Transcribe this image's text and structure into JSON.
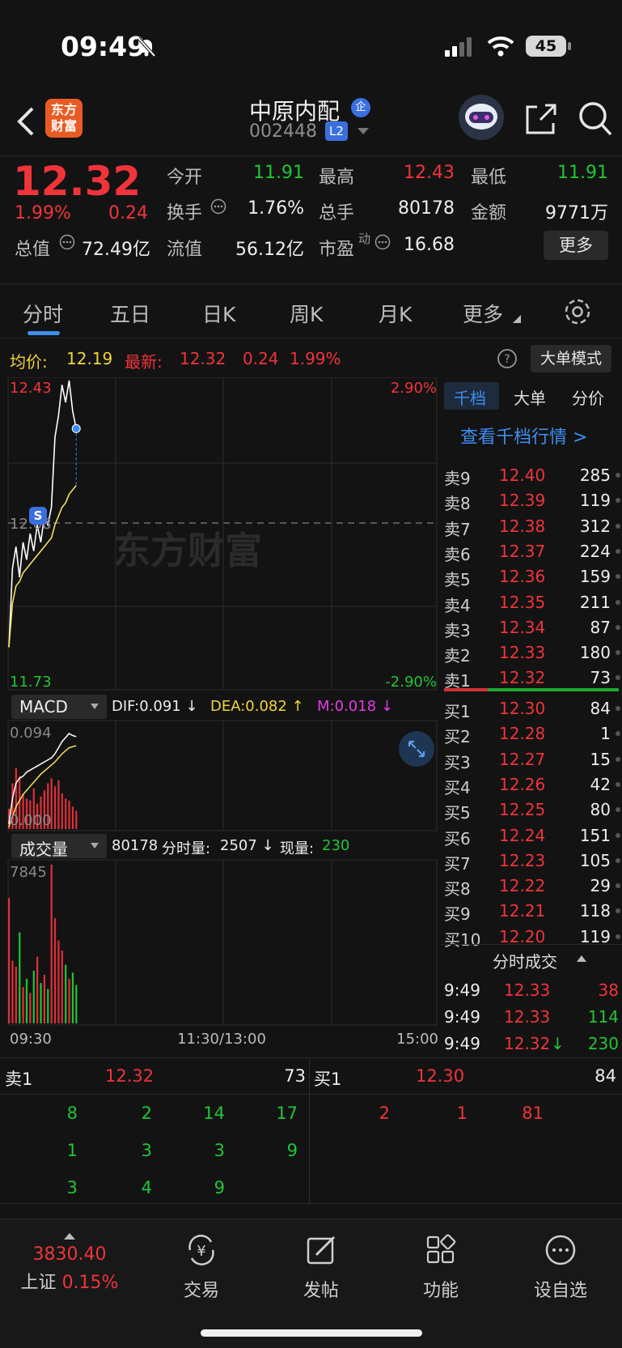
{
  "status_bar": {
    "time": "09:49",
    "battery": "45"
  },
  "header": {
    "logo_text": "东方\n财富",
    "stock_name": "中原内配",
    "badge": "企",
    "code": "002448",
    "level": "L2"
  },
  "quote": {
    "price": "12.32",
    "change_pct": "1.99%",
    "change": "0.24",
    "open_label": "今开",
    "open": "11.91",
    "high_label": "最高",
    "high": "12.43",
    "low_label": "最低",
    "low": "11.91",
    "turnover_label": "换手",
    "turnover": "1.76%",
    "volume_label": "总手",
    "volume": "80178",
    "amount_label": "金额",
    "amount": "9771万",
    "mktcap_label": "总值",
    "mktcap": "72.49亿",
    "float_label": "流值",
    "float": "56.12亿",
    "pe_label": "市盈",
    "pe_sup": "动",
    "pe": "16.68",
    "more_button": "更多"
  },
  "tabs": [
    "分时",
    "五日",
    "日K",
    "周K",
    "月K",
    "更多"
  ],
  "avg_line": {
    "avg_label": "均价:",
    "avg": "12.19",
    "latest_label": "最新:",
    "latest": "12.32",
    "change": "0.24",
    "pct": "1.99%",
    "mode_button": "大单模式"
  },
  "price_chart": {
    "y_top": "12.43",
    "y_mid": "12.08",
    "y_bottom": "11.73",
    "pct_top": "2.90%",
    "pct_bottom": "-2.90%",
    "watermark": "东方财富",
    "marker": "S"
  },
  "macd": {
    "selector": "MACD",
    "dif": "DIF:0.091",
    "dea": "DEA:0.082",
    "m": "M:0.018",
    "y_top": "0.094",
    "y_bottom": "0.000"
  },
  "volume_panel": {
    "selector": "成交量",
    "total": "80178",
    "period_label": "分时量:",
    "period": "2507",
    "current_label": "现量:",
    "current": "230",
    "y_top": "7845"
  },
  "time_axis": [
    "09:30",
    "11:30/13:00",
    "15:00"
  ],
  "chart_data": {
    "type": "line",
    "title": "",
    "x": [
      "09:30",
      "09:31",
      "09:32",
      "09:33",
      "09:34",
      "09:35",
      "09:36",
      "09:37",
      "09:38",
      "09:39",
      "09:40",
      "09:41",
      "09:42",
      "09:43",
      "09:44",
      "09:45",
      "09:46",
      "09:47",
      "09:48",
      "09:49"
    ],
    "series": [
      {
        "name": "",
        "values": [
          11.82,
          12.0,
          12.05,
          11.98,
          12.06,
          12.02,
          12.08,
          12.04,
          12.1,
          12.06,
          12.12,
          12.1,
          12.14,
          12.3,
          12.35,
          12.42,
          12.38,
          12.43,
          12.36,
          12.32
        ]
      },
      {
        "name": "均价",
        "values": [
          11.82,
          11.92,
          11.96,
          11.97,
          11.99,
          12.0,
          12.01,
          12.02,
          12.03,
          12.04,
          12.05,
          12.06,
          12.07,
          12.1,
          12.12,
          12.14,
          12.15,
          12.17,
          12.18,
          12.19
        ]
      }
    ],
    "ylim": [
      11.73,
      12.43
    ],
    "macd_bars": [
      0.02,
      0.045,
      0.06,
      0.052,
      0.035,
      0.03,
      0.028,
      0.04,
      0.025,
      0.032,
      0.038,
      0.045,
      0.05,
      0.042,
      0.048,
      0.035,
      0.03,
      0.028,
      0.022,
      0.018
    ],
    "macd_dif": [
      0.005,
      0.03,
      0.045,
      0.05,
      0.052,
      0.056,
      0.058,
      0.06,
      0.062,
      0.064,
      0.066,
      0.068,
      0.07,
      0.074,
      0.08,
      0.086,
      0.09,
      0.094,
      0.092,
      0.091
    ],
    "macd_dea": [
      0.002,
      0.012,
      0.022,
      0.028,
      0.034,
      0.038,
      0.042,
      0.046,
      0.05,
      0.054,
      0.057,
      0.06,
      0.063,
      0.066,
      0.07,
      0.074,
      0.077,
      0.08,
      0.081,
      0.082
    ],
    "macd_ylim": [
      0.0,
      0.094
    ],
    "volume": [
      6200,
      3100,
      2800,
      4500,
      1800,
      2200,
      1500,
      2600,
      3300,
      2000,
      2400,
      1700,
      7845,
      5200,
      4100,
      3600,
      2900,
      2200,
      2507,
      1900
    ],
    "volume_ylim": [
      0,
      7845
    ]
  },
  "order_book": {
    "tabs": [
      "千档",
      "大单",
      "分价"
    ],
    "view_link": "查看千档行情 >",
    "asks": [
      {
        "label": "卖9",
        "price": "12.40",
        "vol": "285"
      },
      {
        "label": "卖8",
        "price": "12.39",
        "vol": "119"
      },
      {
        "label": "卖7",
        "price": "12.38",
        "vol": "312"
      },
      {
        "label": "卖6",
        "price": "12.37",
        "vol": "224"
      },
      {
        "label": "卖5",
        "price": "12.36",
        "vol": "159"
      },
      {
        "label": "卖4",
        "price": "12.35",
        "vol": "211"
      },
      {
        "label": "卖3",
        "price": "12.34",
        "vol": "87"
      },
      {
        "label": "卖2",
        "price": "12.33",
        "vol": "180"
      },
      {
        "label": "卖1",
        "price": "12.32",
        "vol": "73"
      }
    ],
    "bids": [
      {
        "label": "买1",
        "price": "12.30",
        "vol": "84"
      },
      {
        "label": "买2",
        "price": "12.28",
        "vol": "1"
      },
      {
        "label": "买3",
        "price": "12.27",
        "vol": "15"
      },
      {
        "label": "买4",
        "price": "12.26",
        "vol": "42"
      },
      {
        "label": "买5",
        "price": "12.25",
        "vol": "80"
      },
      {
        "label": "买6",
        "price": "12.24",
        "vol": "151"
      },
      {
        "label": "买7",
        "price": "12.23",
        "vol": "105"
      },
      {
        "label": "买8",
        "price": "12.22",
        "vol": "29"
      },
      {
        "label": "买9",
        "price": "12.21",
        "vol": "118"
      },
      {
        "label": "买10",
        "price": "12.20",
        "vol": "119"
      }
    ],
    "trades_header": "分时成交",
    "trades": [
      {
        "time": "9:49",
        "price": "12.33",
        "vol": "38",
        "arrow": ""
      },
      {
        "time": "9:49",
        "price": "12.33",
        "vol": "114",
        "arrow": ""
      },
      {
        "time": "9:49",
        "price": "12.32",
        "vol": "230",
        "arrow": "↓"
      }
    ]
  },
  "level1": {
    "sell_label": "卖1",
    "sell_price": "12.32",
    "sell_vol": "73",
    "buy_label": "买1",
    "buy_price": "12.30",
    "buy_vol": "84",
    "sell_queue": [
      "8",
      "2",
      "14",
      "17",
      "1",
      "3",
      "3",
      "9",
      "3",
      "4",
      "9"
    ],
    "buy_queue": [
      "2",
      "1",
      "81"
    ]
  },
  "bottom_nav": {
    "index_value": "3830.40",
    "index_name": "上证",
    "index_pct": "0.15%",
    "trade": "交易",
    "post": "发帖",
    "function": "功能",
    "watchlist": "设自选"
  }
}
